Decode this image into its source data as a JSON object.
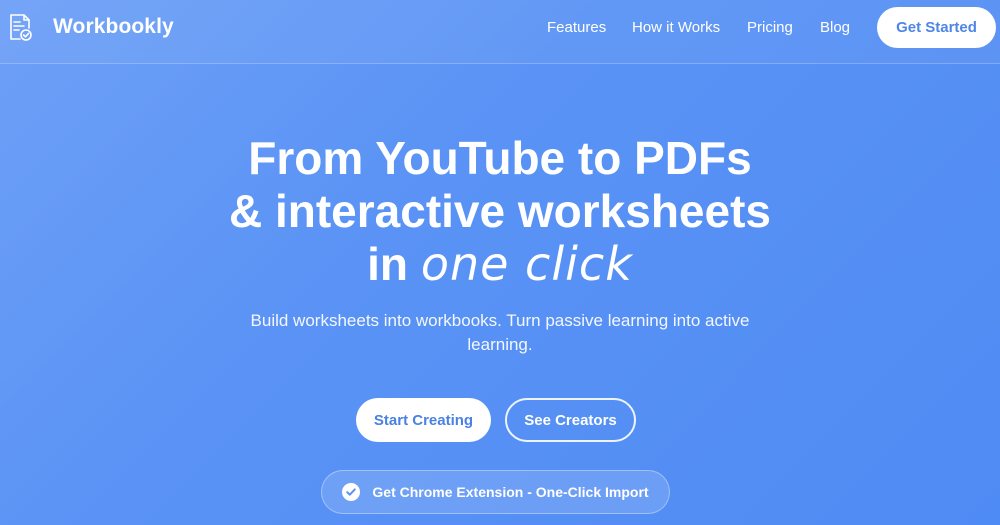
{
  "header": {
    "brand": "Workbookly",
    "nav": [
      "Features",
      "How it Works",
      "Pricing",
      "Blog"
    ],
    "cta": "Get Started"
  },
  "hero": {
    "title_line1": "From YouTube to PDFs",
    "title_line2": "& interactive worksheets",
    "title_line3_bold": "in",
    "title_line3_accent": "one click",
    "subtitle": "Build worksheets into workbooks. Turn passive learning into active learning.",
    "primary_button": "Start Creating",
    "secondary_button": "See Creators",
    "extension_button": "Get Chrome Extension - One-Click Import"
  },
  "icons": {
    "logo": "worksheet-check-icon",
    "extension": "check-circle-icon"
  },
  "colors": {
    "background_start": "#6ea0f7",
    "background_end": "#4f8bf4",
    "button_text": "#4a82e4"
  }
}
